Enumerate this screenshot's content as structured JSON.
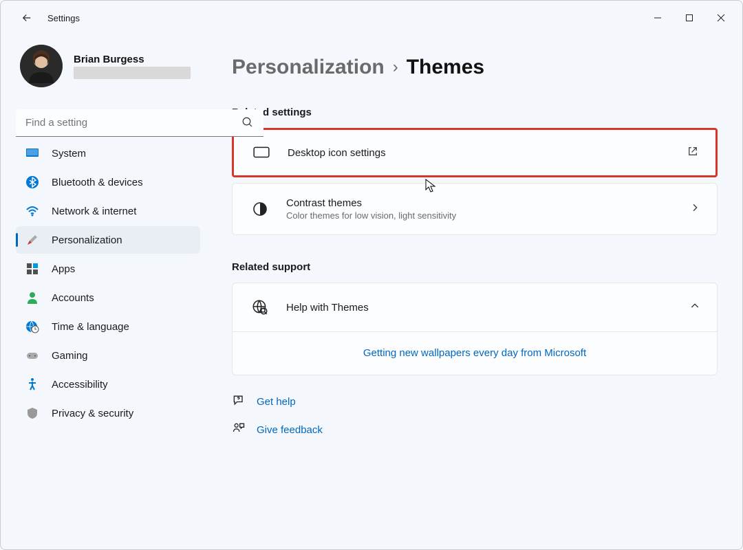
{
  "window": {
    "title": "Settings"
  },
  "profile": {
    "name": "Brian Burgess"
  },
  "search": {
    "placeholder": "Find a setting"
  },
  "nav": {
    "system": "System",
    "bluetooth": "Bluetooth & devices",
    "network": "Network & internet",
    "personalization": "Personalization",
    "apps": "Apps",
    "accounts": "Accounts",
    "time": "Time & language",
    "gaming": "Gaming",
    "accessibility": "Accessibility",
    "privacy": "Privacy & security"
  },
  "breadcrumb": {
    "parent": "Personalization",
    "current": "Themes"
  },
  "sections": {
    "related_settings": "Related settings",
    "related_support": "Related support"
  },
  "cards": {
    "desktop_icon": {
      "title": "Desktop icon settings"
    },
    "contrast": {
      "title": "Contrast themes",
      "sub": "Color themes for low vision, light sensitivity"
    },
    "help_themes": {
      "title": "Help with Themes"
    },
    "wallpapers_link": "Getting new wallpapers every day from Microsoft"
  },
  "footer": {
    "get_help": "Get help",
    "give_feedback": "Give feedback"
  }
}
